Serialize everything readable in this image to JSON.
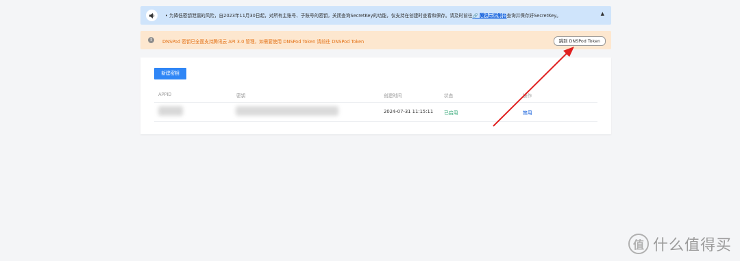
{
  "info_banner": {
    "icon": "speaker-icon",
    "text": "为降低密钥泄漏的风险，自2023年11月30日起，对所有主账号、子账号的密钥，关闭查询SecretKey的功能，仅支持在创建时查看和保存。请及时前往",
    "link": "腾讯云控制台",
    "text_after": "查询并保存好SecretKey。",
    "collapse_icon": "collapse-up-icon"
  },
  "warn_banner": {
    "icon": "warning-icon",
    "text": "DNSPod 密钥已全面支持腾讯云 API 3.0 管理，如需要使用 DNSPod Token 请前往 DNSPod Token",
    "button": "跳到 DNSPod Token"
  },
  "card": {
    "new_button": "新建密钥",
    "columns": [
      "APPID",
      "密钥",
      "创建时间",
      "状态",
      "操作"
    ],
    "rows": [
      {
        "created": "2024-07-31 11:15:11",
        "status": "已启用",
        "action": "禁用"
      }
    ]
  },
  "colors": {
    "accent": "#2f86f6",
    "success": "#2ba471",
    "warning_text": "#e37318",
    "arrow": "#e02020"
  },
  "watermark": {
    "badge": "值",
    "text": "什么值得买"
  }
}
